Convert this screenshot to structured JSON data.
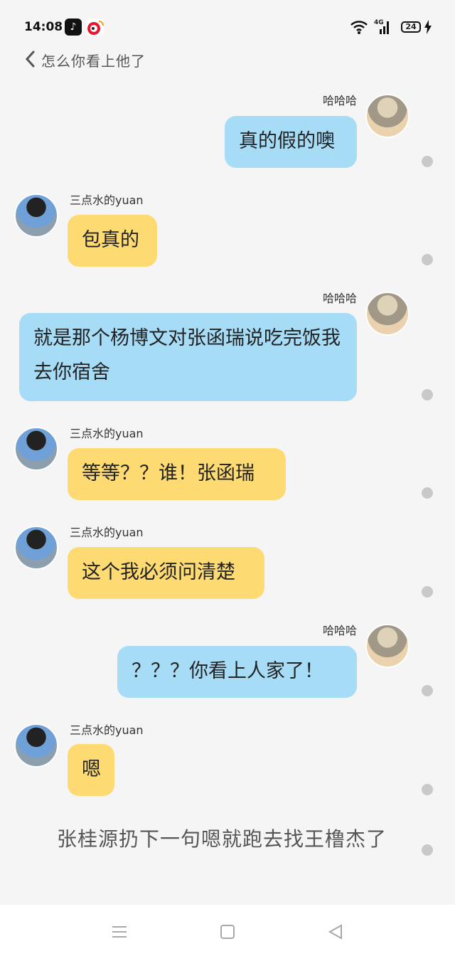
{
  "status": {
    "time": "14:08",
    "network": "4G",
    "battery": "24"
  },
  "header": {
    "back_icon": "chevron-left",
    "title": "怎么你看上他了"
  },
  "contacts": {
    "right": "哈哈哈",
    "left": "三点水的yuan"
  },
  "messages": [
    {
      "text": "真的假的噢"
    },
    {
      "text": "包真的"
    },
    {
      "text": "就是那个杨博文对张函瑞说吃完饭我去你宿舍"
    },
    {
      "text": "等等？？谁！张函瑞"
    },
    {
      "text": "这个我必须问清楚"
    },
    {
      "text": "？？？你看上人家了！"
    },
    {
      "text": "嗯"
    }
  ],
  "footer_text": "张桂源扔下一句嗯就跑去找王橹杰了",
  "colors": {
    "right_bubble": "#a7dcf7",
    "left_bubble": "#fddb72",
    "background": "#f5f5f5"
  }
}
